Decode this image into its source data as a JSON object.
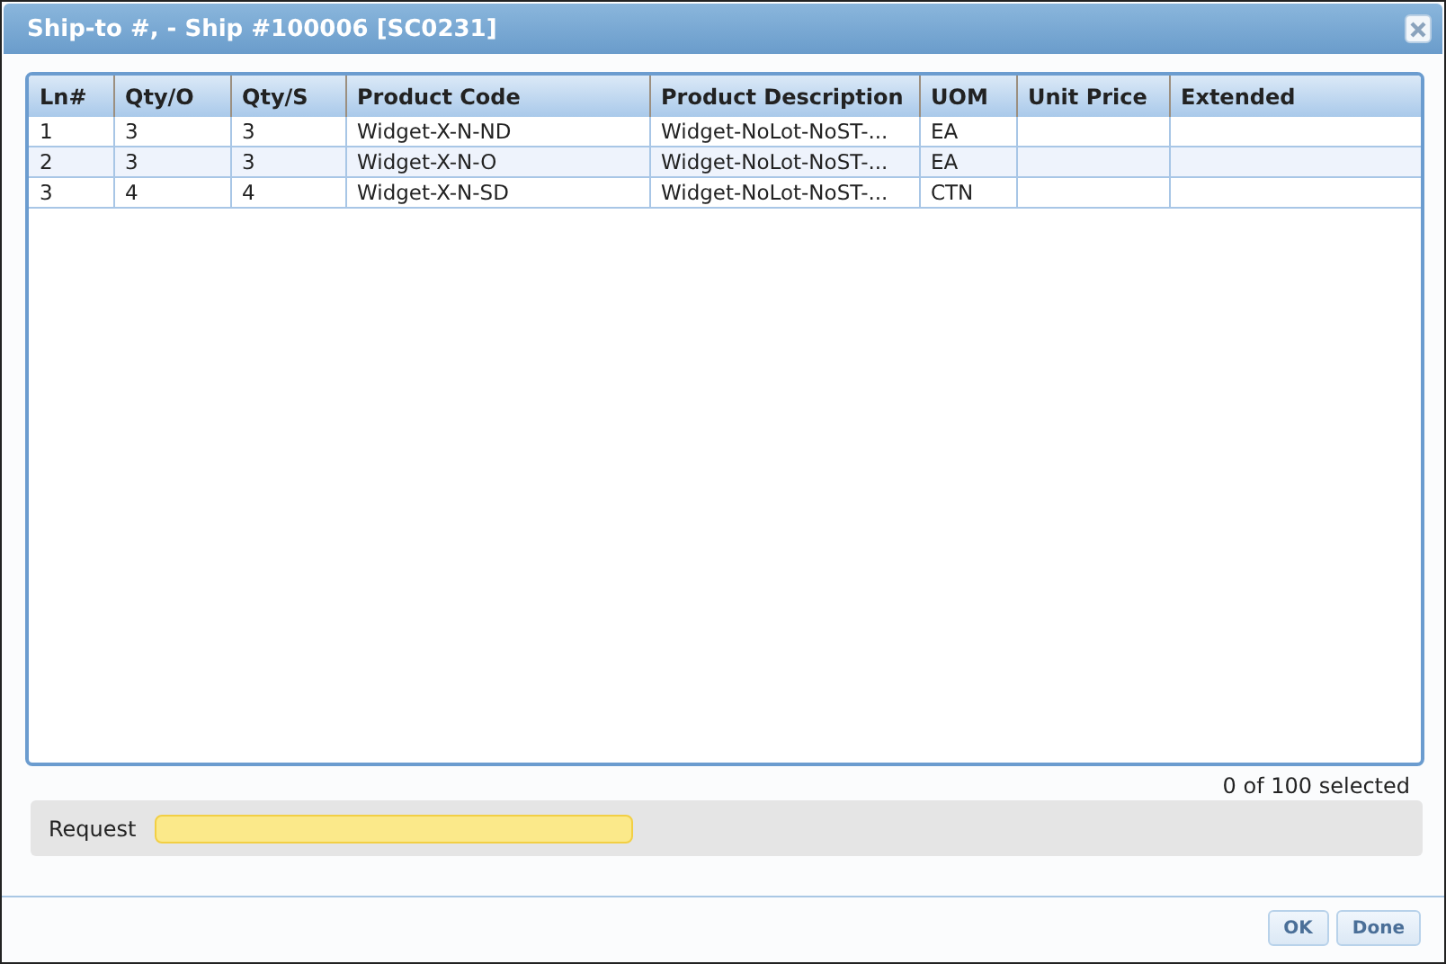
{
  "window": {
    "title": "Ship-to #, - Ship #100006 [SC0231]"
  },
  "table": {
    "columns": [
      "Ln#",
      "Qty/O",
      "Qty/S",
      "Product Code",
      "Product Description",
      "UOM",
      "Unit Price",
      "Extended"
    ],
    "rows": [
      {
        "cells": [
          "1",
          "3",
          "3",
          "Widget-X-N-ND",
          "Widget-NoLot-NoST-...",
          "EA",
          "",
          ""
        ]
      },
      {
        "cells": [
          "2",
          "3",
          "3",
          "Widget-X-N-O",
          "Widget-NoLot-NoST-...",
          "EA",
          "",
          ""
        ]
      },
      {
        "cells": [
          "3",
          "4",
          "4",
          "Widget-X-N-SD",
          "Widget-NoLot-NoST-...",
          "CTN",
          "",
          ""
        ]
      }
    ]
  },
  "selection_count": "0 of 100 selected",
  "request": {
    "label": "Request"
  },
  "buttons": [
    "OK",
    "Done"
  ]
}
